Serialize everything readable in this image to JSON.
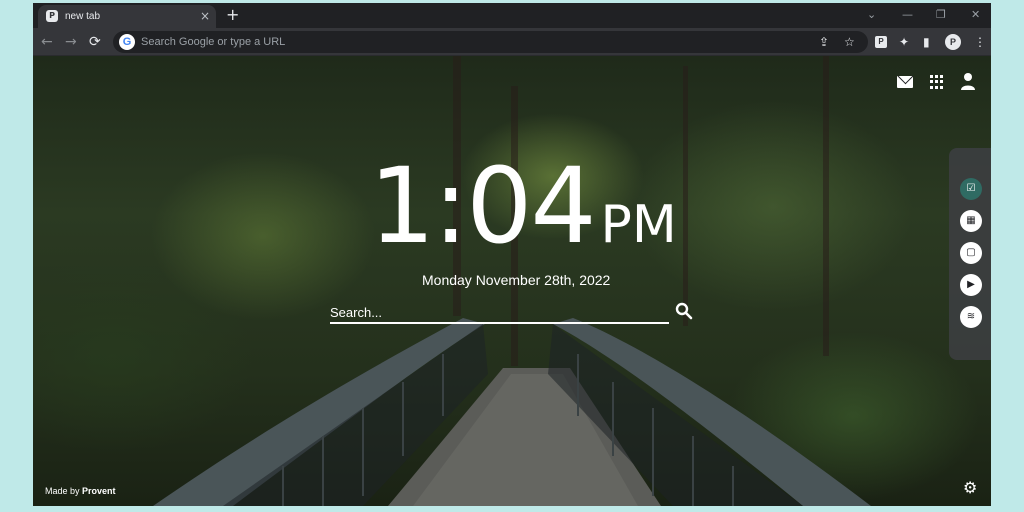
{
  "browser": {
    "tab": {
      "title": "new tab",
      "favicon": "provent-favicon",
      "close": "×"
    },
    "new_tab": "+",
    "window_controls": {
      "dropdown": "⌄",
      "minimize": "—",
      "restore": "❐",
      "close": "✕"
    },
    "nav": {
      "back": "←",
      "forward": "→",
      "reload": "⟳"
    },
    "omnibox": {
      "placeholder": "Search Google or type a URL",
      "google_letter": "G"
    },
    "toolbar_icons": [
      "share-icon",
      "star-icon",
      "provent-extension-icon",
      "puzzle-icon",
      "sidepanel-icon",
      "profile-avatar",
      "menu-icon"
    ],
    "extension_letter": "P",
    "profile_letter": "P",
    "menu": "⋮",
    "star": "☆",
    "share": "⇪",
    "puzzle": "✦",
    "sidepanel": "▮"
  },
  "newtab": {
    "clock": {
      "time": "1:04",
      "ampm": "PM"
    },
    "date": "Monday November 28th, 2022",
    "search": {
      "placeholder": "Search..."
    },
    "top_icons": [
      "mail-icon",
      "apps-grid-icon",
      "user-icon"
    ],
    "side_panel": [
      {
        "name": "todo-list-icon",
        "glyph": "☑",
        "active": true
      },
      {
        "name": "calendar-icon",
        "glyph": "▦",
        "active": false
      },
      {
        "name": "notes-icon",
        "glyph": "▢",
        "active": false
      },
      {
        "name": "youtube-icon",
        "glyph": "▶",
        "active": false
      },
      {
        "name": "spotify-icon",
        "glyph": "≋",
        "active": false
      }
    ],
    "footer": {
      "made_by_prefix": "Made by",
      "brand": "Provent"
    },
    "settings_glyph": "⚙"
  },
  "colors": {
    "page_border": "#bfe9e8",
    "chrome_dark": "#202124",
    "chrome_toolbar": "#35363a",
    "accent_active": "#2f6b63"
  }
}
